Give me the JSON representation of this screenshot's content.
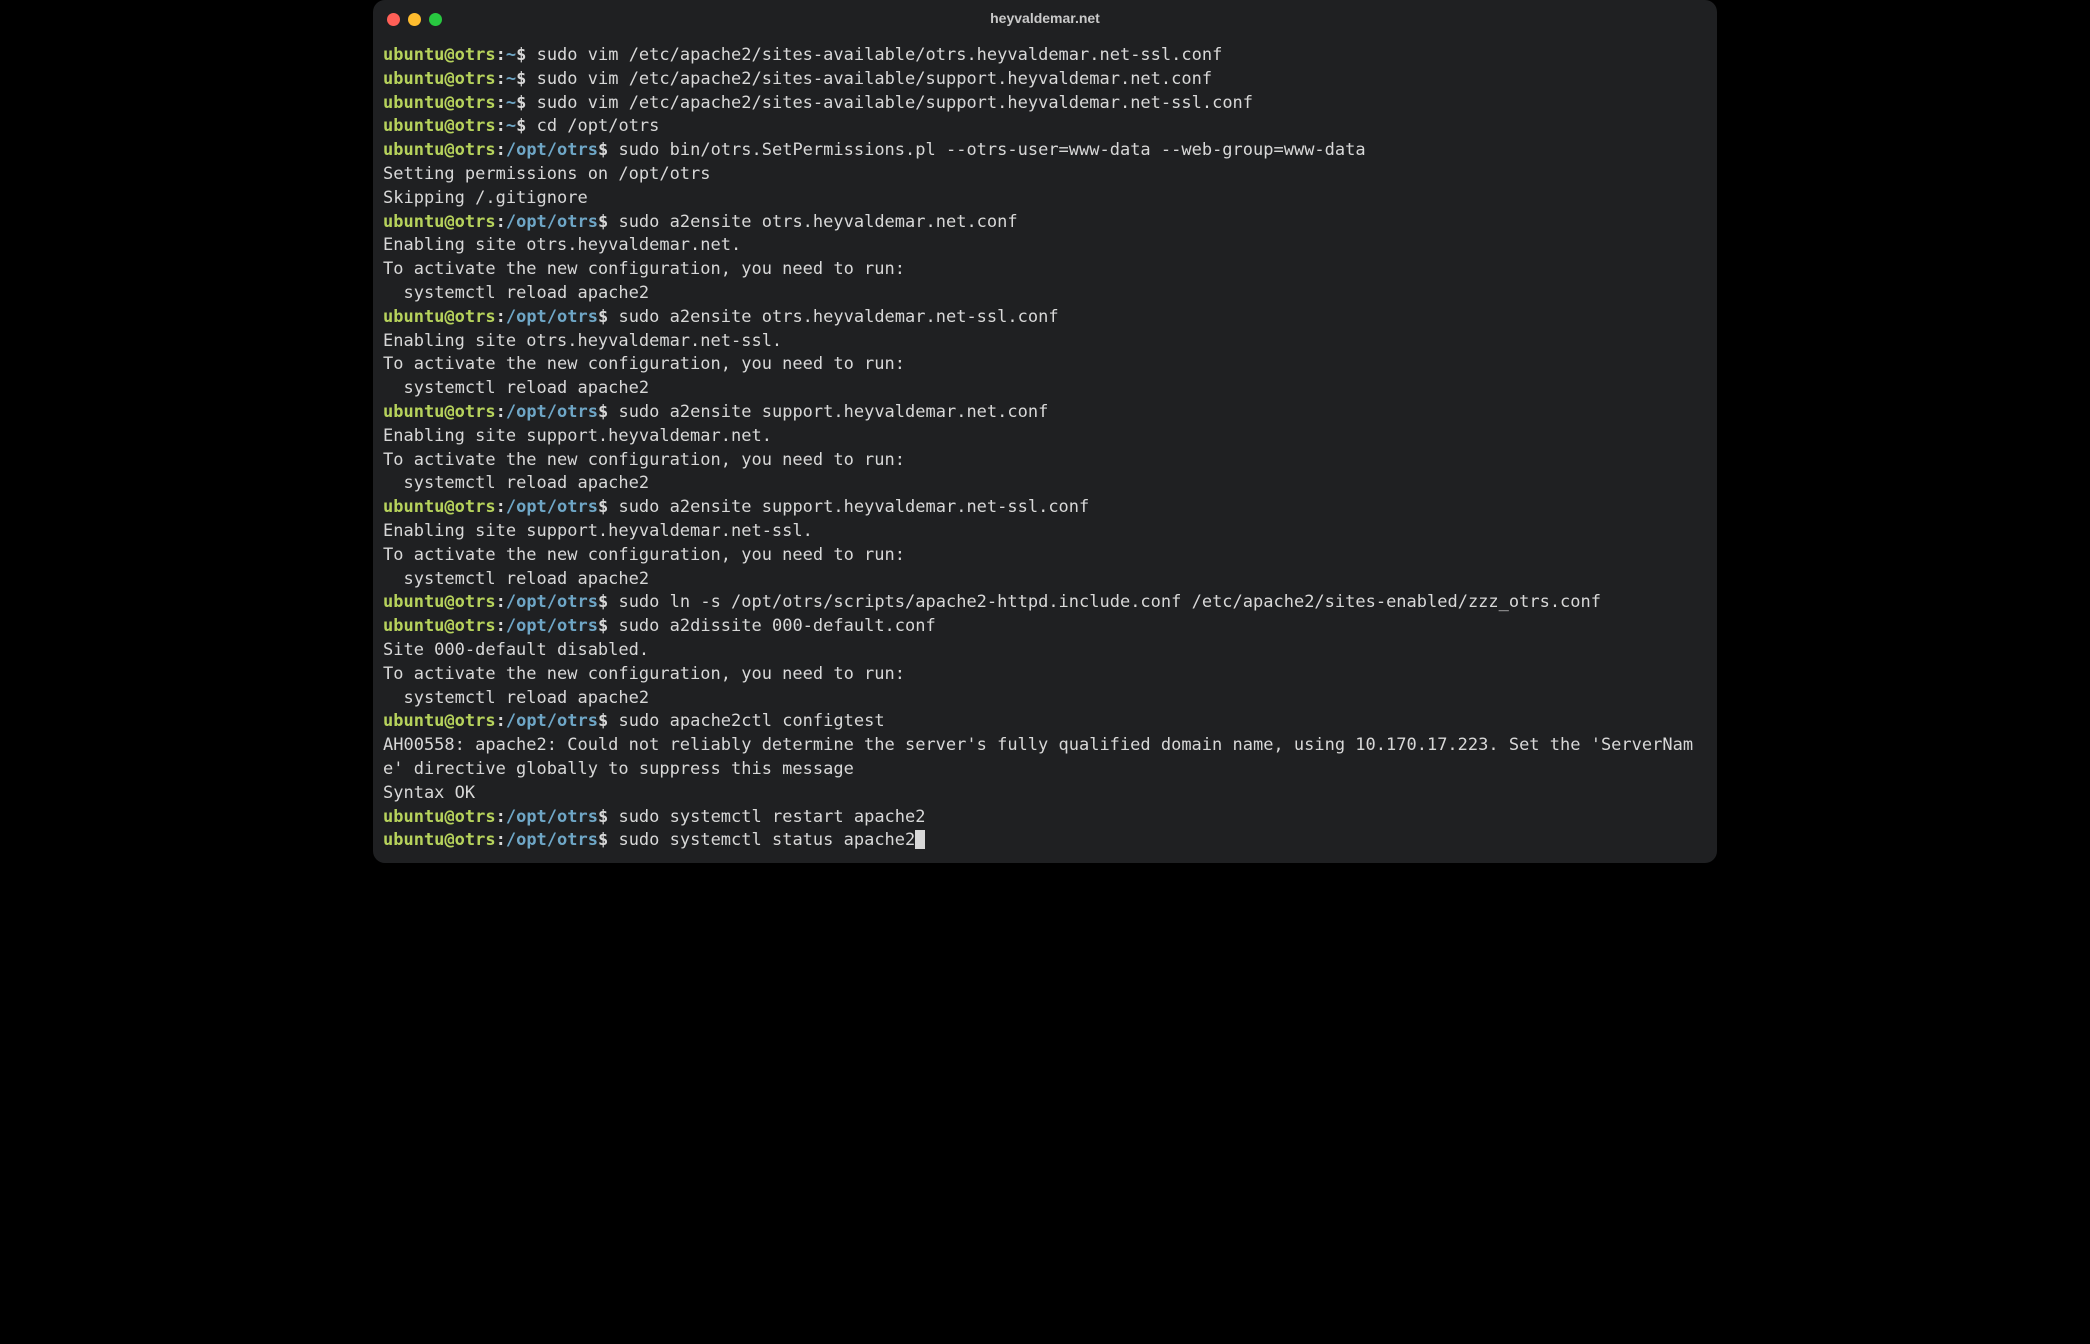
{
  "title": "heyvaldemar.net",
  "prompt": {
    "user_host": "ubuntu@otrs",
    "home_path": "~",
    "opt_path": "/opt/otrs",
    "dollar": "$"
  },
  "lines": [
    {
      "t": "p",
      "path": "home",
      "cmd": "sudo vim /etc/apache2/sites-available/otrs.heyvaldemar.net-ssl.conf"
    },
    {
      "t": "p",
      "path": "home",
      "cmd": "sudo vim /etc/apache2/sites-available/support.heyvaldemar.net.conf"
    },
    {
      "t": "p",
      "path": "home",
      "cmd": "sudo vim /etc/apache2/sites-available/support.heyvaldemar.net-ssl.conf"
    },
    {
      "t": "p",
      "path": "home",
      "cmd": "cd /opt/otrs"
    },
    {
      "t": "p",
      "path": "opt",
      "cmd": "sudo bin/otrs.SetPermissions.pl --otrs-user=www-data --web-group=www-data"
    },
    {
      "t": "o",
      "text": "Setting permissions on /opt/otrs"
    },
    {
      "t": "o",
      "text": "Skipping /.gitignore"
    },
    {
      "t": "p",
      "path": "opt",
      "cmd": "sudo a2ensite otrs.heyvaldemar.net.conf"
    },
    {
      "t": "o",
      "text": "Enabling site otrs.heyvaldemar.net."
    },
    {
      "t": "o",
      "text": "To activate the new configuration, you need to run:"
    },
    {
      "t": "o",
      "text": "  systemctl reload apache2"
    },
    {
      "t": "p",
      "path": "opt",
      "cmd": "sudo a2ensite otrs.heyvaldemar.net-ssl.conf"
    },
    {
      "t": "o",
      "text": "Enabling site otrs.heyvaldemar.net-ssl."
    },
    {
      "t": "o",
      "text": "To activate the new configuration, you need to run:"
    },
    {
      "t": "o",
      "text": "  systemctl reload apache2"
    },
    {
      "t": "p",
      "path": "opt",
      "cmd": "sudo a2ensite support.heyvaldemar.net.conf"
    },
    {
      "t": "o",
      "text": "Enabling site support.heyvaldemar.net."
    },
    {
      "t": "o",
      "text": "To activate the new configuration, you need to run:"
    },
    {
      "t": "o",
      "text": "  systemctl reload apache2"
    },
    {
      "t": "p",
      "path": "opt",
      "cmd": "sudo a2ensite support.heyvaldemar.net-ssl.conf"
    },
    {
      "t": "o",
      "text": "Enabling site support.heyvaldemar.net-ssl."
    },
    {
      "t": "o",
      "text": "To activate the new configuration, you need to run:"
    },
    {
      "t": "o",
      "text": "  systemctl reload apache2"
    },
    {
      "t": "p",
      "path": "opt",
      "cmd": "sudo ln -s /opt/otrs/scripts/apache2-httpd.include.conf /etc/apache2/sites-enabled/zzz_otrs.conf"
    },
    {
      "t": "p",
      "path": "opt",
      "cmd": "sudo a2dissite 000-default.conf"
    },
    {
      "t": "o",
      "text": "Site 000-default disabled."
    },
    {
      "t": "o",
      "text": "To activate the new configuration, you need to run:"
    },
    {
      "t": "o",
      "text": "  systemctl reload apache2"
    },
    {
      "t": "p",
      "path": "opt",
      "cmd": "sudo apache2ctl configtest"
    },
    {
      "t": "o",
      "text": "AH00558: apache2: Could not reliably determine the server's fully qualified domain name, using 10.170.17.223. Set the 'ServerName' directive globally to suppress this message"
    },
    {
      "t": "o",
      "text": "Syntax OK"
    },
    {
      "t": "p",
      "path": "opt",
      "cmd": "sudo systemctl restart apache2"
    },
    {
      "t": "p",
      "path": "opt",
      "cmd": "sudo systemctl status apache2",
      "cursor": true
    }
  ]
}
